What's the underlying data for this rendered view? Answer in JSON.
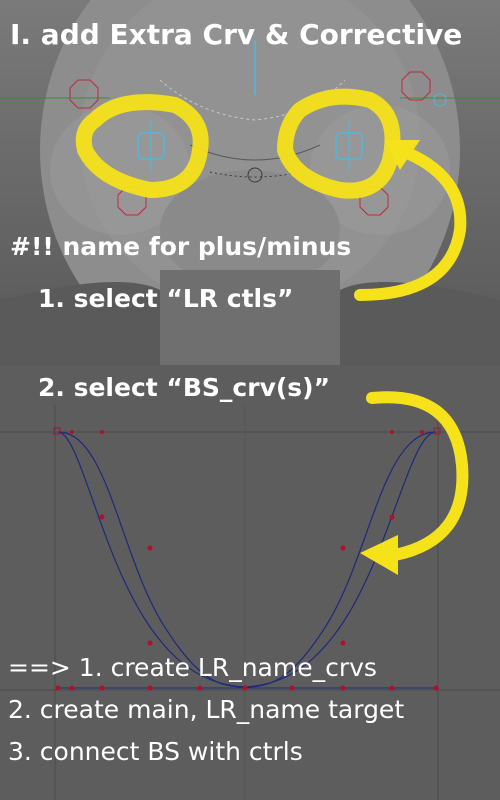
{
  "top_panel": {
    "title": "I. add Extra Crv & Corrective",
    "note": "#!! name for plus/minus",
    "step1": "1. select  “LR ctls”"
  },
  "bottom_panel": {
    "step2": "2. select “BS_crv(s)”",
    "result": {
      "line1": "==> 1. create LR_name_crvs",
      "line2": "2. create main, LR_name target",
      "line3": "3. connect BS with ctrls"
    }
  },
  "colors": {
    "highlight": "#f6e21a",
    "control_blue": "#4fb8e0",
    "curve": "#1e2a7a",
    "point": "#b0102a"
  }
}
